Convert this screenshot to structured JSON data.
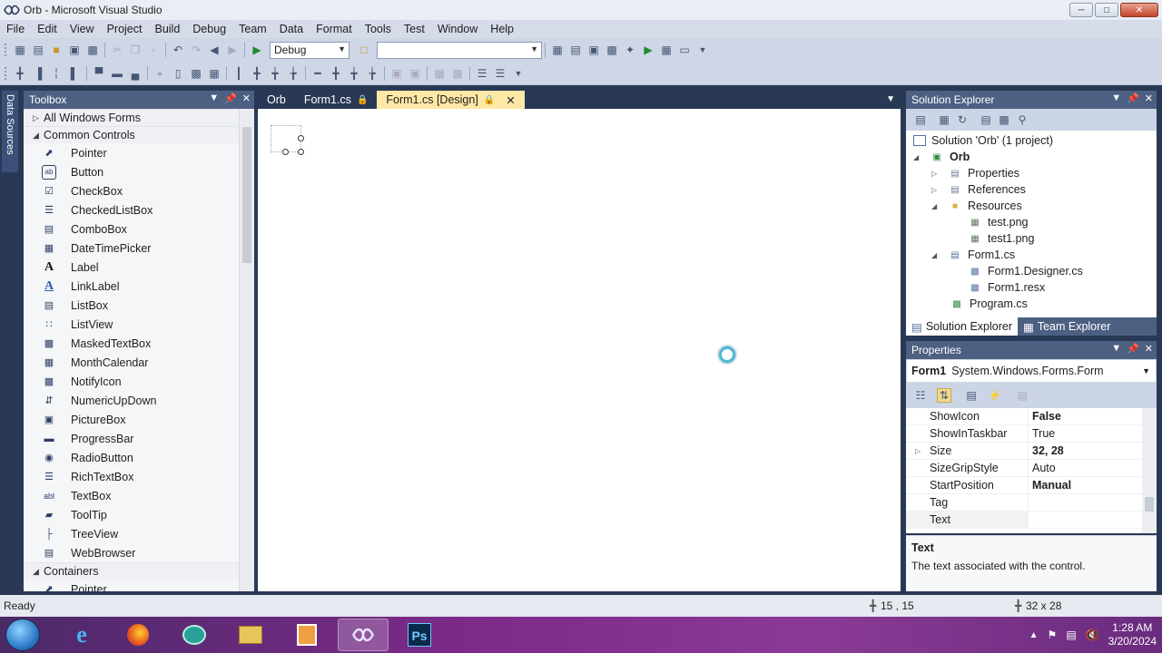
{
  "window": {
    "title": "Orb - Microsoft Visual Studio",
    "minimize": "─",
    "maximize": "□",
    "close": "✕"
  },
  "menu": [
    "File",
    "Edit",
    "View",
    "Project",
    "Build",
    "Debug",
    "Team",
    "Data",
    "Format",
    "Tools",
    "Test",
    "Window",
    "Help"
  ],
  "toolbar": {
    "config": "Debug",
    "platform": ""
  },
  "side_strip": {
    "data_sources": "Data Sources"
  },
  "toolbox": {
    "title": "Toolbox",
    "groups": [
      {
        "label": "All Windows Forms",
        "expanded": false
      },
      {
        "label": "Common Controls",
        "expanded": true
      }
    ],
    "items": [
      {
        "label": "Pointer",
        "icon": "pointer-icon"
      },
      {
        "label": "Button",
        "icon": "button-icon"
      },
      {
        "label": "CheckBox",
        "icon": "checkbox-icon"
      },
      {
        "label": "CheckedListBox",
        "icon": "checkedlistbox-icon"
      },
      {
        "label": "ComboBox",
        "icon": "combobox-icon"
      },
      {
        "label": "DateTimePicker",
        "icon": "datetimepicker-icon"
      },
      {
        "label": "Label",
        "icon": "label-icon"
      },
      {
        "label": "LinkLabel",
        "icon": "linklabel-icon"
      },
      {
        "label": "ListBox",
        "icon": "listbox-icon"
      },
      {
        "label": "ListView",
        "icon": "listview-icon"
      },
      {
        "label": "MaskedTextBox",
        "icon": "maskedtextbox-icon"
      },
      {
        "label": "MonthCalendar",
        "icon": "monthcalendar-icon"
      },
      {
        "label": "NotifyIcon",
        "icon": "notifyicon-icon"
      },
      {
        "label": "NumericUpDown",
        "icon": "numericupdown-icon"
      },
      {
        "label": "PictureBox",
        "icon": "picturebox-icon"
      },
      {
        "label": "ProgressBar",
        "icon": "progressbar-icon"
      },
      {
        "label": "RadioButton",
        "icon": "radiobutton-icon"
      },
      {
        "label": "RichTextBox",
        "icon": "richtextbox-icon"
      },
      {
        "label": "TextBox",
        "icon": "textbox-icon"
      },
      {
        "label": "ToolTip",
        "icon": "tooltip-icon"
      },
      {
        "label": "TreeView",
        "icon": "treeview-icon"
      },
      {
        "label": "WebBrowser",
        "icon": "webbrowser-icon"
      }
    ],
    "containers_group": "Containers",
    "containers_first": "Pointer"
  },
  "doc_tabs": [
    {
      "label": "Orb",
      "locked": false,
      "active": false
    },
    {
      "label": "Form1.cs",
      "locked": true,
      "active": false
    },
    {
      "label": "Form1.cs [Design]",
      "locked": true,
      "active": true
    }
  ],
  "solution_explorer": {
    "title": "Solution Explorer",
    "tree": [
      {
        "label": "Solution 'Orb' (1 project)",
        "icon": "solution-icon",
        "bold": false
      },
      {
        "label": "Orb",
        "icon": "csharp-project-icon",
        "bold": true,
        "expander": "◢"
      },
      {
        "label": "Properties",
        "icon": "properties-folder-icon",
        "expander": "▷"
      },
      {
        "label": "References",
        "icon": "references-icon",
        "expander": "▷"
      },
      {
        "label": "Resources",
        "icon": "folder-icon",
        "expander": "◢"
      },
      {
        "label": "test.png",
        "icon": "image-file-icon"
      },
      {
        "label": "test1.png",
        "icon": "image-file-icon"
      },
      {
        "label": "Form1.cs",
        "icon": "form-icon",
        "expander": "◢"
      },
      {
        "label": "Form1.Designer.cs",
        "icon": "cs-file-icon"
      },
      {
        "label": "Form1.resx",
        "icon": "resx-file-icon"
      },
      {
        "label": "Program.cs",
        "icon": "cs-file-icon"
      }
    ],
    "tabs": [
      "Solution Explorer",
      "Team Explorer"
    ]
  },
  "properties": {
    "title": "Properties",
    "object_name": "Form1",
    "object_type": "System.Windows.Forms.Form",
    "rows": [
      {
        "name": "ShowIcon",
        "value": "False",
        "bold": true
      },
      {
        "name": "ShowInTaskbar",
        "value": "True",
        "bold": false
      },
      {
        "name": "Size",
        "value": "32, 28",
        "bold": true,
        "expandable": true
      },
      {
        "name": "SizeGripStyle",
        "value": "Auto",
        "bold": false
      },
      {
        "name": "StartPosition",
        "value": "Manual",
        "bold": true
      },
      {
        "name": "Tag",
        "value": "",
        "bold": false
      },
      {
        "name": "Text",
        "value": "",
        "bold": false
      }
    ],
    "desc_title": "Text",
    "desc_text": "The text associated with the control."
  },
  "status": {
    "left": "Ready",
    "position": "15 , 15",
    "size": "32 x 28"
  },
  "taskbar": {
    "time": "1:28 AM",
    "date": "3/20/2024"
  },
  "colors": {
    "vs_chrome": "#293955",
    "panel_header": "#4d6082",
    "active_tab": "#ffe8a6",
    "taskbar": "#7d2a8a"
  }
}
